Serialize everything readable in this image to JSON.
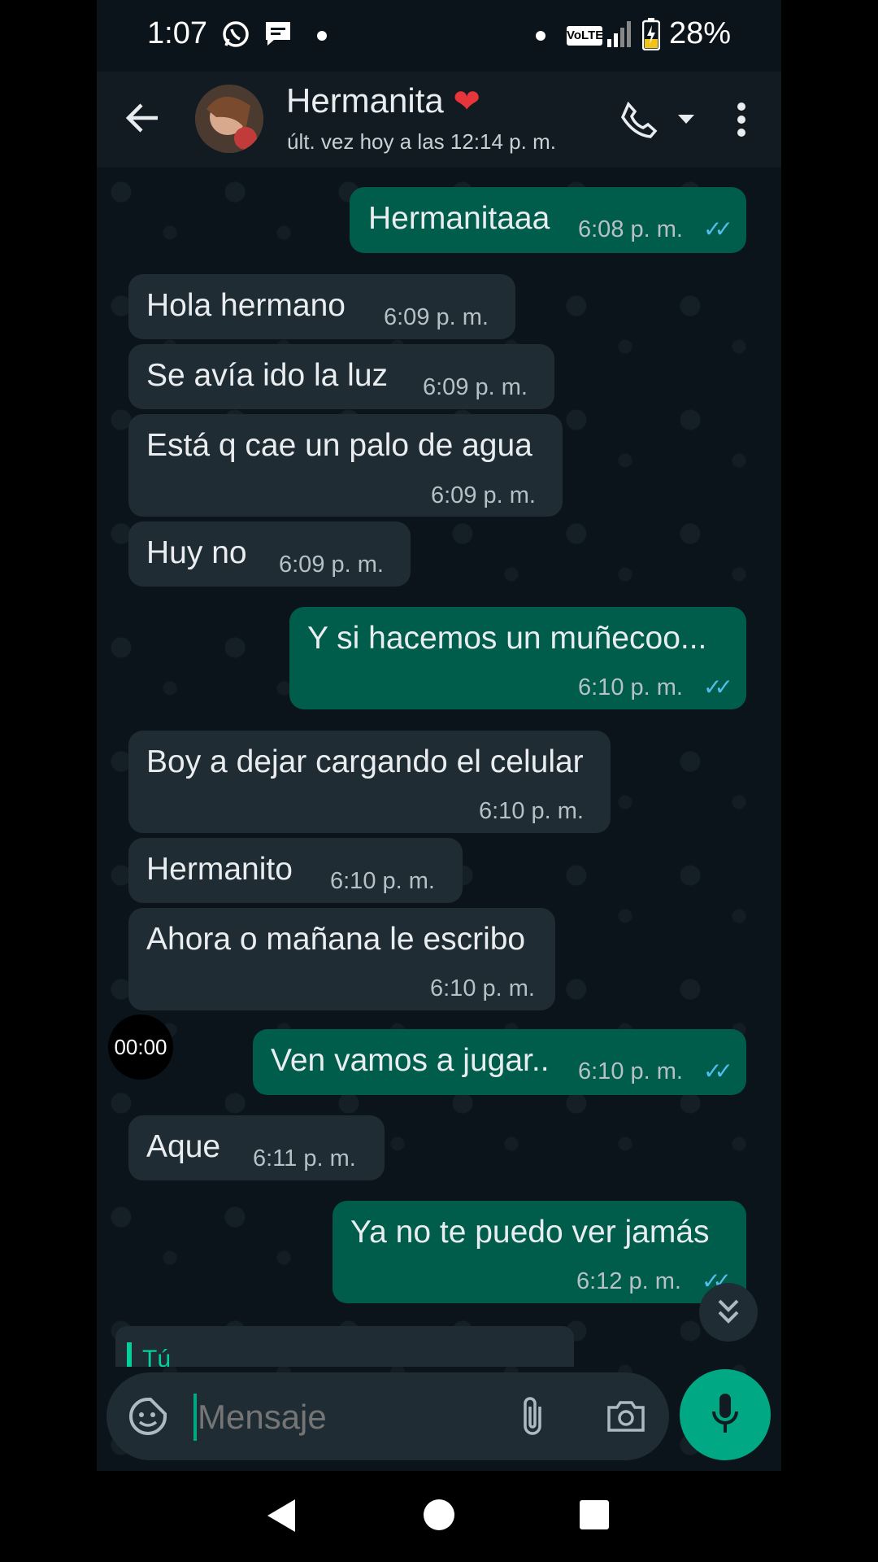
{
  "status_bar": {
    "time": "1:07",
    "network": "VoLTE",
    "battery": "28%"
  },
  "header": {
    "contact_name": "Hermanita",
    "heart": "❤",
    "last_seen": "últ. vez hoy a las 12:14 p. m.",
    "icons": [
      "back-arrow-icon",
      "avatar",
      "phone-icon",
      "dropdown-icon",
      "more-options-icon"
    ]
  },
  "messages": [
    {
      "dir": "out",
      "text": "Hermanitaaa",
      "time": "6:08 p. m.",
      "read": true
    },
    {
      "dir": "in",
      "text": "Hola hermano",
      "time": "6:09 p. m."
    },
    {
      "dir": "in",
      "text": "Se avía ido la luz",
      "time": "6:09 p. m."
    },
    {
      "dir": "in",
      "text": "Está q cae un palo de agua",
      "time": "6:09 p. m."
    },
    {
      "dir": "in",
      "text": "Huy no",
      "time": "6:09 p. m."
    },
    {
      "dir": "out",
      "text": "Y si hacemos un muñecoo...",
      "time": "6:10 p. m.",
      "read": true
    },
    {
      "dir": "in",
      "text": "Boy a dejar cargando el celular",
      "time": "6:10 p. m."
    },
    {
      "dir": "in",
      "text": "Hermanito",
      "time": "6:10 p. m."
    },
    {
      "dir": "in",
      "text": "Ahora o mañana le escribo",
      "time": "6:10 p. m."
    },
    {
      "dir": "out",
      "text": "Ven vamos a jugar..",
      "time": "6:10 p. m.",
      "read": true
    },
    {
      "dir": "in",
      "text": "Aque",
      "time": "6:11 p. m."
    },
    {
      "dir": "out",
      "text": "Ya no te puedo ver jamás",
      "time": "6:12 p. m.",
      "read": true
    }
  ],
  "audio_timer": "00:00",
  "reply_preview_label": "Tú",
  "composer": {
    "placeholder": "Mensaje"
  },
  "colors": {
    "incoming_bubble": "#202c33",
    "outgoing_bubble": "#005c4b",
    "accent": "#00a884",
    "read_ticks": "#53bdeb"
  }
}
